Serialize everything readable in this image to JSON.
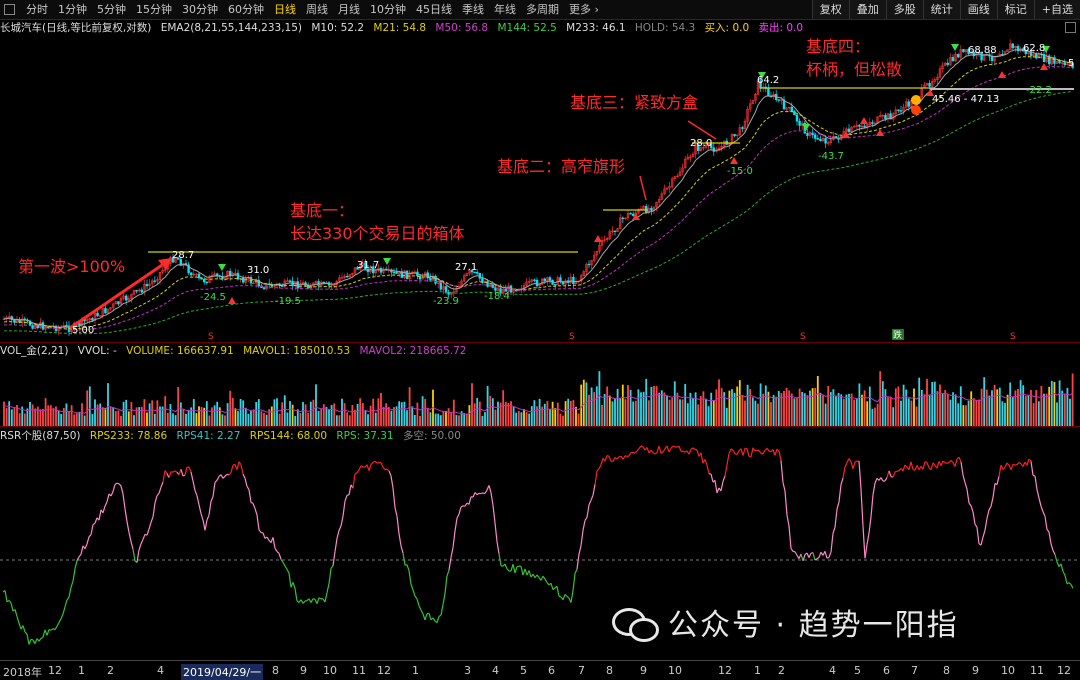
{
  "toolbar": {
    "timeframes": [
      "分时",
      "1分钟",
      "5分钟",
      "15分钟",
      "30分钟",
      "60分钟",
      "日线",
      "周线",
      "月线",
      "10分钟",
      "45日线",
      "季线",
      "年线",
      "多周期",
      "更多 ›"
    ],
    "active": "日线",
    "right_buttons": [
      "复权",
      "叠加",
      "多股",
      "统计",
      "画线",
      "标记",
      "+自选"
    ]
  },
  "legend_main": {
    "title": "长城汽车(日线,等比前复权,对数)",
    "ema": "EMA2(8,21,55,144,233,15)",
    "m10": "M10: 52.2",
    "m21": "M21: 54.8",
    "m50": "M50: 56.8",
    "m144": "M144: 52.5",
    "m233": "M233: 46.1",
    "hold": "HOLD: 54.3",
    "buy": "买入: 0.0",
    "sell": "卖出: 0.0"
  },
  "legend_vol": {
    "title": "VOL_金(2,21)",
    "vvol": "VVOL: -",
    "volume": "VOLUME: 166637.91",
    "mavol1": "MAVOL1: 185010.53",
    "mavol2": "MAVOL2: 218665.72"
  },
  "legend_rsr": {
    "title": "RSR个股(87,50)",
    "rps233": "RPS233: 78.86",
    "rps41": "RPS41: 2.27",
    "rps144": "RPS144: 68.00",
    "rps": "RPS: 37.31",
    "kong": "多空: 50.00"
  },
  "annotations": {
    "wave1": "第一波>100%",
    "base1_line1": "基底一：",
    "base1_line2": "长达330个交易日的箱体",
    "base2": "基底二：高窄旗形",
    "base3": "基底三：紧致方盒",
    "base4_line1": "基底四：",
    "base4_line2": "杯柄，但松散"
  },
  "price_labels": {
    "p5": "5.00",
    "p287": "28.7",
    "p245": "-24.5",
    "p310": "31.0",
    "p195": "-19.5",
    "p317": "31.7",
    "p271": "27.1",
    "p239": "-23.9",
    "p184": "-18.4",
    "p280": "28.0",
    "p150": "-15.0",
    "p642": "64.2",
    "p437": "-43.7",
    "p6888": "68.88",
    "p628": "62.8",
    "p222": "-22.2",
    "range": "45.46 - 47.13",
    "edge": "5"
  },
  "markers": {
    "s": "S",
    "die": "跌"
  },
  "xaxis": {
    "labels": [
      "2018年",
      "12",
      "1",
      "2",
      "4",
      "2019/04/29/一",
      "8",
      "9",
      "10",
      "11",
      "12",
      "1",
      "3",
      "4",
      "5",
      "6",
      "7",
      "8",
      "9",
      "10",
      "12",
      "1",
      "2",
      "4",
      "5",
      "6",
      "7",
      "8",
      "9",
      "10",
      "11",
      "12"
    ]
  },
  "watermark": "公众号 · 趋势一阳指",
  "colors": {
    "up": "#ff3030",
    "down": "#00e5ff",
    "yellow": "#d4d400",
    "green": "#33c433",
    "pink": "#ff88c8",
    "red": "#ff2020"
  }
}
